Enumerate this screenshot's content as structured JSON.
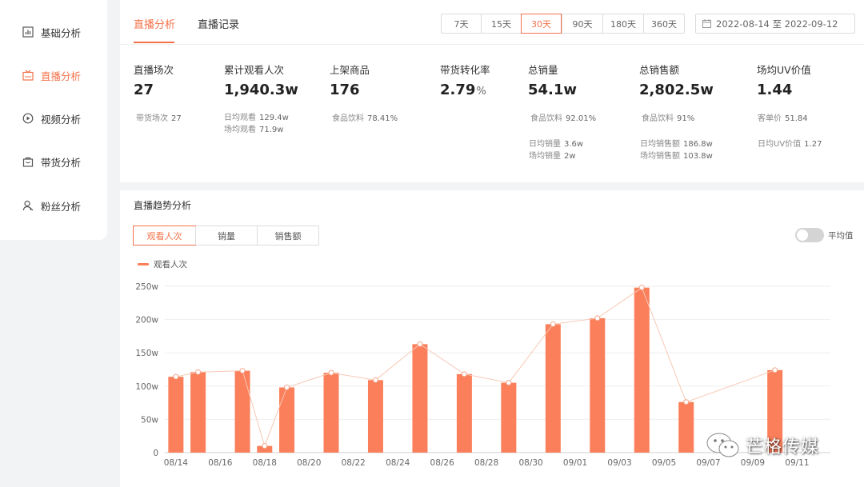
{
  "sidebar": {
    "items": [
      {
        "label": "基础分析",
        "icon": "bar-chart-icon",
        "active": false
      },
      {
        "label": "直播分析",
        "icon": "live-tv-icon",
        "active": true
      },
      {
        "label": "视频分析",
        "icon": "play-circle-icon",
        "active": false
      },
      {
        "label": "带货分析",
        "icon": "shopping-bag-icon",
        "active": false
      },
      {
        "label": "粉丝分析",
        "icon": "user-icon",
        "active": false
      }
    ]
  },
  "tabs": [
    {
      "label": "直播分析",
      "active": true
    },
    {
      "label": "直播记录",
      "active": false
    }
  ],
  "range": {
    "options": [
      "7天",
      "15天",
      "30天",
      "90天",
      "180天",
      "360天"
    ],
    "selected": "30天"
  },
  "date_range": "2022-08-14 至 2022-09-12",
  "metrics": [
    {
      "label": "直播场次",
      "value": "27",
      "unit": "",
      "subs": [
        {
          "label": "带货场次",
          "value": "27"
        }
      ]
    },
    {
      "label": "累计观看人次",
      "value": "1,940.3w",
      "unit": "",
      "subs": [
        {
          "label": "日均观看",
          "value": "129.4w"
        },
        {
          "label": "场均观看",
          "value": "71.9w"
        }
      ]
    },
    {
      "label": "上架商品",
      "value": "176",
      "unit": "",
      "subs": [
        {
          "label": "食品饮料",
          "value": "78.41%"
        }
      ]
    },
    {
      "label": "带货转化率",
      "value": "2.79",
      "unit": "%",
      "subs": []
    },
    {
      "label": "总销量",
      "value": "54.1w",
      "unit": "",
      "subs": [
        {
          "label": "食品饮料",
          "value": "92.01%"
        },
        {
          "label": "日均销量",
          "value": "3.6w"
        },
        {
          "label": "场均销量",
          "value": "2w"
        }
      ]
    },
    {
      "label": "总销售额",
      "value": "2,802.5w",
      "unit": "",
      "subs": [
        {
          "label": "食品饮料",
          "value": "91%"
        },
        {
          "label": "日均销售额",
          "value": "186.8w"
        },
        {
          "label": "场均销售额",
          "value": "103.8w"
        }
      ]
    },
    {
      "label": "场均UV价值",
      "value": "1.44",
      "unit": "",
      "subs": [
        {
          "label": "客单价",
          "value": "51.84"
        },
        {
          "label": "日均UV价值",
          "value": "1.27"
        }
      ]
    }
  ],
  "trend": {
    "title": "直播趋势分析",
    "metric_tabs": [
      {
        "label": "观看人次",
        "active": true
      },
      {
        "label": "销量",
        "active": false
      },
      {
        "label": "销售额",
        "active": false
      }
    ],
    "toggle_label": "平均值",
    "toggle_on": false
  },
  "watermark": "芒格传媒",
  "colors": {
    "accent": "#f4724a",
    "bar": "#fa7f5a",
    "line": "#f8c8b4"
  },
  "chart_data": {
    "type": "bar",
    "series": [
      {
        "name": "观看人次",
        "values": [
          114,
          121,
          null,
          123,
          10,
          98,
          null,
          120,
          null,
          109,
          null,
          163,
          null,
          118,
          null,
          105,
          null,
          193,
          null,
          202,
          null,
          248,
          null,
          76,
          null,
          null,
          null,
          124
        ]
      }
    ],
    "x": [
      "08/14",
      "08/15",
      "08/16",
      "08/17",
      "08/18",
      "08/19",
      "08/20",
      "08/21",
      "08/22",
      "08/23",
      "08/24",
      "08/25",
      "08/26",
      "08/27",
      "08/28",
      "08/29",
      "08/30",
      "08/31",
      "09/01",
      "09/02",
      "09/03",
      "09/04",
      "09/05",
      "09/06",
      "09/07",
      "09/08",
      "09/09",
      "09/10",
      "09/11",
      "09/12"
    ],
    "xtick_labels": [
      "08/14",
      "08/16",
      "08/18",
      "08/20",
      "08/22",
      "08/24",
      "08/26",
      "08/28",
      "08/30",
      "09/01",
      "09/03",
      "09/05",
      "09/07",
      "09/09",
      "09/11"
    ],
    "yticks": [
      "0",
      "50w",
      "100w",
      "150w",
      "200w",
      "250w"
    ],
    "ylim": [
      0,
      250
    ],
    "grid": true,
    "legend": "top-left"
  }
}
